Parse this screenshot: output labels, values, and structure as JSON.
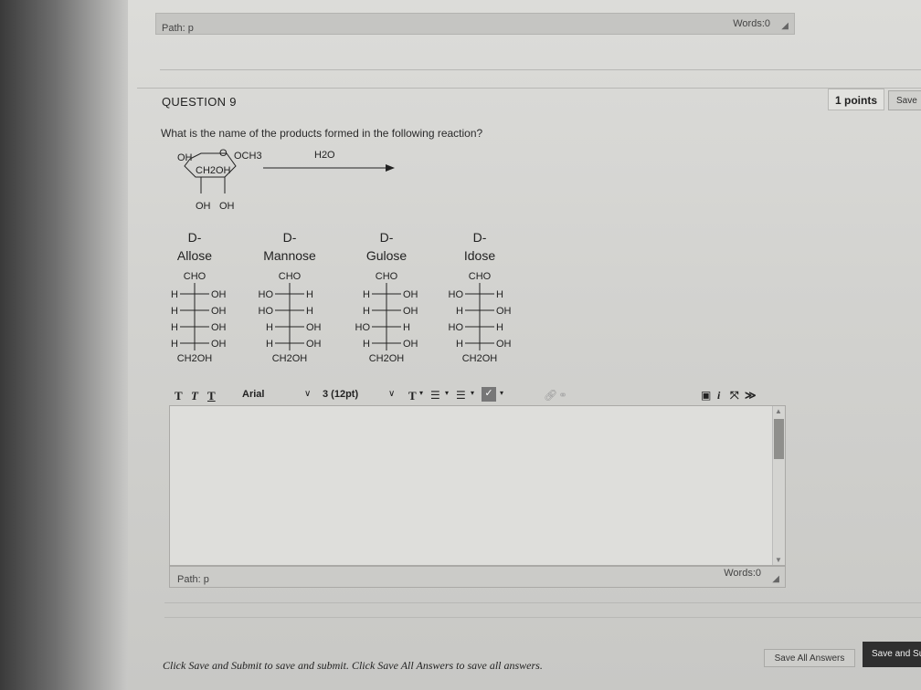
{
  "top_editor": {
    "path_label": "Path: p",
    "words_label": "Words:0"
  },
  "question": {
    "number_label": "QUESTION 9",
    "points_label": "1 points",
    "save_label": "Save",
    "text": "What is the name of the products formed in the following reaction?"
  },
  "reaction": {
    "ring_labels": [
      "OH",
      "O",
      "OCH3",
      "CH2OH",
      "OH",
      "OH"
    ],
    "reagent": "H2O"
  },
  "options": [
    {
      "title_line1": "D-",
      "title_line2": "Allose",
      "top": "CHO",
      "rows": [
        [
          "H",
          "OH"
        ],
        [
          "H",
          "OH"
        ],
        [
          "H",
          "OH"
        ],
        [
          "H",
          "OH"
        ]
      ],
      "bottom": "CH2OH"
    },
    {
      "title_line1": "D-",
      "title_line2": "Mannose",
      "top": "CHO",
      "rows": [
        [
          "HO",
          "H"
        ],
        [
          "HO",
          "H"
        ],
        [
          "H",
          "OH"
        ],
        [
          "H",
          "OH"
        ]
      ],
      "bottom": "CH2OH"
    },
    {
      "title_line1": "D-",
      "title_line2": "Gulose",
      "top": "CHO",
      "rows": [
        [
          "H",
          "OH"
        ],
        [
          "H",
          "OH"
        ],
        [
          "HO",
          "H"
        ],
        [
          "H",
          "OH"
        ]
      ],
      "bottom": "CH2OH"
    },
    {
      "title_line1": "D-",
      "title_line2": "Idose",
      "top": "CHO",
      "rows": [
        [
          "HO",
          "H"
        ],
        [
          "H",
          "OH"
        ],
        [
          "HO",
          "H"
        ],
        [
          "H",
          "OH"
        ]
      ],
      "bottom": "CH2OH"
    }
  ],
  "toolbar": {
    "text_buttons": [
      "T",
      "T",
      "T"
    ],
    "font_family": "Arial",
    "font_size": "3 (12pt)",
    "icons": [
      "text-color-icon",
      "bullet-list-icon",
      "numbered-list-icon",
      "spellcheck-icon",
      "link-icon",
      "unlink-icon",
      "preview-icon",
      "info-icon",
      "expand-icon",
      "chevron-double-down-icon"
    ]
  },
  "answer_editor": {
    "path_label": "Path: p",
    "words_label": "Words:0"
  },
  "footer": {
    "instructions": "Click Save and Submit to save and submit. Click Save All Answers to save all answers.",
    "save_all_label": "Save All Answers",
    "save_submit_label": "Save and Su"
  }
}
